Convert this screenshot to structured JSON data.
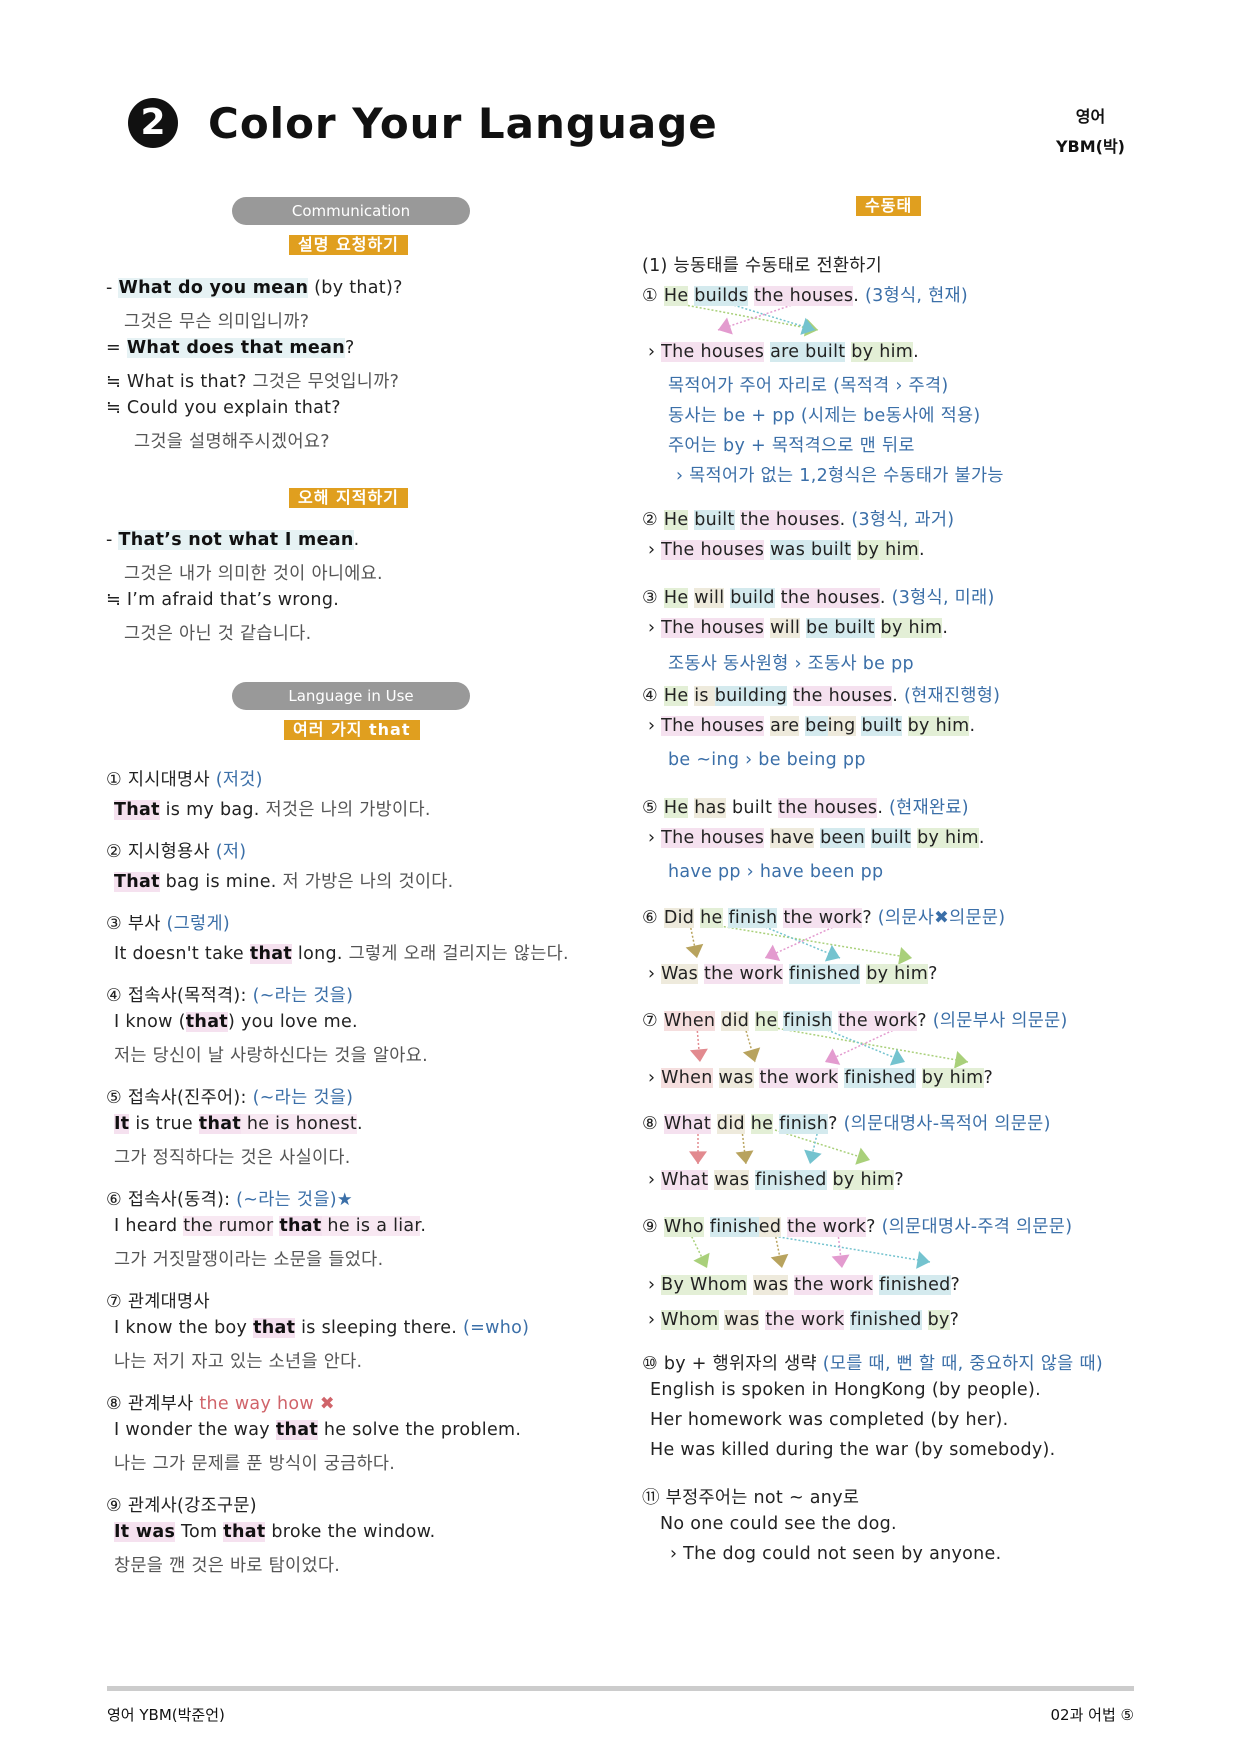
{
  "header": {
    "lesson_number": "2",
    "title": "Color Your Language",
    "subject_line1": "영어",
    "subject_line2": "YBM(박)"
  },
  "left": {
    "communication_pill": "Communication",
    "tag1": "설명 요청하기",
    "c1": {
      "prefix": "- ",
      "bold": "What do you mean",
      "rest": " (by that)?"
    },
    "c1_ko": "그것은 무슨 의미입니까?",
    "c2": {
      "prefix": "= ",
      "bold": "What does that mean",
      "rest": "?"
    },
    "c3": {
      "prefix": "≒ ",
      "text": "What is that? ",
      "ko": "그것은 무엇입니까?"
    },
    "c4": {
      "prefix": "≒ ",
      "text": "Could you explain that?"
    },
    "c4_ko": "그것을 설명해주시겠어요?",
    "tag2": "오해 지적하기",
    "d1": {
      "prefix": "- ",
      "bold": "That’s not what I mean",
      "rest": "."
    },
    "d1_ko": "그것은 내가 의미한 것이 아니에요.",
    "d2": {
      "prefix": "≒ ",
      "text": "I’m afraid that’s wrong."
    },
    "d2_ko": "그것은 아닌 것 같습니다.",
    "liu_pill": "Language in Use",
    "tag3": "여러 가지 that",
    "items": [
      {
        "num": "①",
        "label": "지시대명사",
        "note": " (저것)",
        "en_parts": [
          {
            "t": "That",
            "hl": "pink",
            "b": true
          },
          {
            "t": " is my bag. "
          }
        ],
        "ko_inline": "저것은 나의 가방이다."
      },
      {
        "num": "②",
        "label": "지시형용사",
        "note": " (저)",
        "en_parts": [
          {
            "t": "That",
            "hl": "pink",
            "b": true
          },
          {
            "t": " bag is mine. "
          }
        ],
        "ko_inline": "저 가방은 나의 것이다."
      },
      {
        "num": "③",
        "label": "부사",
        "note": " (그렇게)",
        "en_parts": [
          {
            "t": "It doesn't take "
          },
          {
            "t": "that",
            "hl": "pink",
            "b": true
          },
          {
            "t": " long. "
          }
        ],
        "ko_inline": "그렇게 오래 걸리지는 않는다."
      },
      {
        "num": "④",
        "label": "접속사(목적격):",
        "note": " (~라는 것을)",
        "en_parts": [
          {
            "t": "I know ("
          },
          {
            "t": "that",
            "hl": "pink",
            "b": true
          },
          {
            "t": ") you love me."
          }
        ],
        "ko": "저는 당신이 날 사랑하신다는 것을 알아요."
      },
      {
        "num": "⑤",
        "label": "접속사(진주어):",
        "note": " (~라는 것을)",
        "en_parts": [
          {
            "t": "It",
            "hl": "pink",
            "b": true
          },
          {
            "t": " is true "
          },
          {
            "t": "that",
            "hl": "pink",
            "b": true
          },
          {
            "t": " he is honest",
            "hl": "lpink"
          },
          {
            "t": "."
          }
        ],
        "ko": "그가 정직하다는 것은 사실이다."
      },
      {
        "num": "⑥",
        "label": "접속사(동격):",
        "note": " (~라는 것을)★",
        "en_parts": [
          {
            "t": "I heard "
          },
          {
            "t": "the rumor",
            "hl": "lpink"
          },
          {
            "t": " "
          },
          {
            "t": "that",
            "hl": "pink",
            "b": true
          },
          {
            "t": " he is a liar",
            "hl": "lpink"
          },
          {
            "t": "."
          }
        ],
        "ko": "그가 거짓말쟁이라는 소문을 들었다."
      },
      {
        "num": "⑦",
        "label": "관계대명사",
        "note": "",
        "en_parts": [
          {
            "t": "I know the boy "
          },
          {
            "t": "that",
            "hl": "pink",
            "b": true
          },
          {
            "t": " is sleeping there. "
          }
        ],
        "en_note": "(=who)",
        "ko": "나는 저기 자고 있는 소년을 안다."
      },
      {
        "num": "⑧",
        "label": "관계부사",
        "red_note": " the way how ✖",
        "en_parts": [
          {
            "t": "I wonder the way "
          },
          {
            "t": "that",
            "hl": "pink",
            "b": true
          },
          {
            "t": " he solve the problem."
          }
        ],
        "ko": "나는 그가 문제를 푼 방식이 궁금하다."
      },
      {
        "num": "⑨",
        "label": "관계사(강조구문)",
        "note": "",
        "en_parts": [
          {
            "t": "It was",
            "hl": "pink",
            "b": true
          },
          {
            "t": " Tom "
          },
          {
            "t": "that",
            "hl": "pink",
            "b": true
          },
          {
            "t": " broke the window."
          }
        ],
        "ko": "창문을 깬 것은 바로 탐이었다."
      }
    ]
  },
  "right": {
    "tag": "수동태",
    "section_title": "(1) 능동태를 수동태로 전환하기",
    "s1": {
      "num": "①",
      "parts": [
        {
          "t": "He",
          "hl": "green"
        },
        {
          "t": " "
        },
        {
          "t": "builds",
          "hl": "blue"
        },
        {
          "t": " "
        },
        {
          "t": "the houses",
          "hl": "pink"
        },
        {
          "t": ". "
        }
      ],
      "note": "(3형식, 현재)"
    },
    "s1p": {
      "parts": [
        {
          "t": "The houses",
          "hl": "pink"
        },
        {
          "t": " "
        },
        {
          "t": "are built",
          "hl": "blue"
        },
        {
          "t": " "
        },
        {
          "t": "by him",
          "hl": "green"
        },
        {
          "t": "."
        }
      ]
    },
    "s1_notes": [
      "목적어가 주어 자리로 (목적격 › 주격)",
      "동사는 be + pp (시제는 be동사에 적용)",
      "주어는 by + 목적격으로 맨 뒤로",
      "› 목적어가 없는 1,2형식은 수동태가 불가능"
    ],
    "s2": {
      "num": "②",
      "parts": [
        {
          "t": "He",
          "hl": "green"
        },
        {
          "t": " "
        },
        {
          "t": "built",
          "hl": "blue"
        },
        {
          "t": " "
        },
        {
          "t": "the houses",
          "hl": "pink"
        },
        {
          "t": ". "
        }
      ],
      "note": "(3형식, 과거)"
    },
    "s2p": {
      "parts": [
        {
          "t": "The houses",
          "hl": "pink"
        },
        {
          "t": " "
        },
        {
          "t": "was built",
          "hl": "blue"
        },
        {
          "t": " "
        },
        {
          "t": "by him",
          "hl": "green"
        },
        {
          "t": "."
        }
      ]
    },
    "s3": {
      "num": "③",
      "parts": [
        {
          "t": "He",
          "hl": "green"
        },
        {
          "t": " "
        },
        {
          "t": "will",
          "hl": "tan"
        },
        {
          "t": " "
        },
        {
          "t": "build",
          "hl": "blue"
        },
        {
          "t": " "
        },
        {
          "t": "the houses",
          "hl": "pink"
        },
        {
          "t": ". "
        }
      ],
      "note": "(3형식, 미래)"
    },
    "s3p": {
      "parts": [
        {
          "t": "The houses",
          "hl": "pink"
        },
        {
          "t": " "
        },
        {
          "t": "will",
          "hl": "tan"
        },
        {
          "t": " "
        },
        {
          "t": "be built",
          "hl": "blue"
        },
        {
          "t": " "
        },
        {
          "t": "by him",
          "hl": "green"
        },
        {
          "t": "."
        }
      ]
    },
    "s3_note": "조동사 동사원형   › 조동사 be pp",
    "s4": {
      "num": "④",
      "parts": [
        {
          "t": "He",
          "hl": "green"
        },
        {
          "t": " "
        },
        {
          "t": "is ",
          "hl": "tan"
        },
        {
          "t": "building",
          "hl": "blue"
        },
        {
          "t": " "
        },
        {
          "t": "the houses",
          "hl": "pink"
        },
        {
          "t": ". "
        }
      ],
      "note": "(현재진행형)"
    },
    "s4p": {
      "parts": [
        {
          "t": "The houses",
          "hl": "pink"
        },
        {
          "t": " "
        },
        {
          "t": "are",
          "hl": "tan"
        },
        {
          "t": " "
        },
        {
          "t": "be",
          "hl": "blue"
        },
        {
          "t": "ing",
          "hl": "tan"
        },
        {
          "t": " "
        },
        {
          "t": "built",
          "hl": "blue"
        },
        {
          "t": " "
        },
        {
          "t": "by him",
          "hl": "green"
        },
        {
          "t": "."
        }
      ]
    },
    "s4_note": "be ~ing   › be being pp",
    "s5": {
      "num": "⑤",
      "parts": [
        {
          "t": "He",
          "hl": "green"
        },
        {
          "t": " "
        },
        {
          "t": "has",
          "hl": "tan"
        },
        {
          "t": " built "
        },
        {
          "t": "the houses",
          "hl": "pink"
        },
        {
          "t": ". "
        }
      ],
      "note": "(현재완료)"
    },
    "s5p": {
      "parts": [
        {
          "t": "The houses",
          "hl": "pink"
        },
        {
          "t": " "
        },
        {
          "t": "have",
          "hl": "tan"
        },
        {
          "t": " "
        },
        {
          "t": "been",
          "hl": "blue"
        },
        {
          "t": " "
        },
        {
          "t": "built",
          "hl": "blue"
        },
        {
          "t": " "
        },
        {
          "t": "by him",
          "hl": "green"
        },
        {
          "t": "."
        }
      ]
    },
    "s5_note": "have pp   › have been pp",
    "s6": {
      "num": "⑥",
      "parts": [
        {
          "t": "Did",
          "hl": "tan"
        },
        {
          "t": " "
        },
        {
          "t": "he",
          "hl": "green"
        },
        {
          "t": " "
        },
        {
          "t": "finish",
          "hl": "blue"
        },
        {
          "t": " "
        },
        {
          "t": "the work",
          "hl": "pink"
        },
        {
          "t": "? "
        }
      ],
      "note": "(의문사✖의문문)"
    },
    "s6p": {
      "parts": [
        {
          "t": "Was",
          "hl": "tan"
        },
        {
          "t": " "
        },
        {
          "t": "the work",
          "hl": "pink"
        },
        {
          "t": " "
        },
        {
          "t": "finished",
          "hl": "blue"
        },
        {
          "t": " "
        },
        {
          "t": "by him",
          "hl": "green"
        },
        {
          "t": "?"
        }
      ]
    },
    "s7": {
      "num": "⑦",
      "parts": [
        {
          "t": "When",
          "hl": "rose"
        },
        {
          "t": " "
        },
        {
          "t": "did",
          "hl": "tan"
        },
        {
          "t": " "
        },
        {
          "t": "he",
          "hl": "green"
        },
        {
          "t": " "
        },
        {
          "t": "finish",
          "hl": "blue"
        },
        {
          "t": " "
        },
        {
          "t": "the work",
          "hl": "pink"
        },
        {
          "t": "? "
        }
      ],
      "note": "(의문부사 의문문)"
    },
    "s7p": {
      "parts": [
        {
          "t": "When",
          "hl": "rose"
        },
        {
          "t": " "
        },
        {
          "t": "was",
          "hl": "tan"
        },
        {
          "t": " "
        },
        {
          "t": "the work",
          "hl": "pink"
        },
        {
          "t": " "
        },
        {
          "t": "finished",
          "hl": "blue"
        },
        {
          "t": " "
        },
        {
          "t": "by him",
          "hl": "green"
        },
        {
          "t": "?"
        }
      ]
    },
    "s8": {
      "num": "⑧",
      "parts": [
        {
          "t": "What",
          "hl": "pink"
        },
        {
          "t": " "
        },
        {
          "t": "did",
          "hl": "tan"
        },
        {
          "t": " "
        },
        {
          "t": "he",
          "hl": "green"
        },
        {
          "t": " "
        },
        {
          "t": "finish",
          "hl": "blue"
        },
        {
          "t": "? "
        }
      ],
      "note": "(의문대명사-목적어 의문문)"
    },
    "s8p": {
      "parts": [
        {
          "t": "What",
          "hl": "pink"
        },
        {
          "t": " "
        },
        {
          "t": "was",
          "hl": "tan"
        },
        {
          "t": " "
        },
        {
          "t": "finished",
          "hl": "blue"
        },
        {
          "t": " "
        },
        {
          "t": "by him",
          "hl": "green"
        },
        {
          "t": "?"
        }
      ]
    },
    "s9": {
      "num": "⑨",
      "parts": [
        {
          "t": "Who",
          "hl": "green"
        },
        {
          "t": " "
        },
        {
          "t": "finish",
          "hl": "blue"
        },
        {
          "t": "ed",
          "hl": "tan"
        },
        {
          "t": " "
        },
        {
          "t": "the work",
          "hl": "pink"
        },
        {
          "t": "? "
        }
      ],
      "note": "(의문대명사-주격 의문문)"
    },
    "s9p1": {
      "parts": [
        {
          "t": "By Whom",
          "hl": "green"
        },
        {
          "t": " "
        },
        {
          "t": "was",
          "hl": "tan"
        },
        {
          "t": " "
        },
        {
          "t": "the work",
          "hl": "pink"
        },
        {
          "t": " "
        },
        {
          "t": "finished",
          "hl": "blue"
        },
        {
          "t": "?"
        }
      ]
    },
    "s9p2": {
      "parts": [
        {
          "t": "Whom",
          "hl": "green"
        },
        {
          "t": " "
        },
        {
          "t": "was",
          "hl": "tan"
        },
        {
          "t": " "
        },
        {
          "t": "the work",
          "hl": "pink"
        },
        {
          "t": " "
        },
        {
          "t": "finished",
          "hl": "blue"
        },
        {
          "t": " "
        },
        {
          "t": "by",
          "hl": "green"
        },
        {
          "t": "?"
        }
      ]
    },
    "s10": {
      "num": "⑩",
      "label": " by + 행위자의 생략 ",
      "note": "(모를 때, 뻔 할 때, 중요하지 않을 때)"
    },
    "s10_lines": [
      "English is spoken in HongKong (by people).",
      "Her homework was completed (by her).",
      "He was killed during the war (by somebody)."
    ],
    "s11": {
      "num": "⑪",
      "label": " 부정주어는 not ~ any로"
    },
    "s11_lines": [
      "No one could see the dog.",
      "› The dog could not seen by anyone."
    ],
    "arrow_marker": "›"
  },
  "footer": {
    "left": "영어 YBM(박준언)",
    "right": "02과 어법 ⑤"
  },
  "colors": {
    "tag_orange": "#e09f1f",
    "pill_gray": "#999999",
    "note_blue": "#3b6fa8",
    "note_red": "#d0646a",
    "hl_pink": "#f5e1ef",
    "hl_green": "#e3efd6",
    "hl_blue": "#d4eaee",
    "hl_tan": "#eeeadc",
    "hl_rose": "#f5dede",
    "arrow_pink": "#e39bcf",
    "arrow_blue": "#74c3cf",
    "arrow_green": "#a9d07a",
    "arrow_tan": "#b8a35e",
    "arrow_rose": "#e28a8f"
  }
}
